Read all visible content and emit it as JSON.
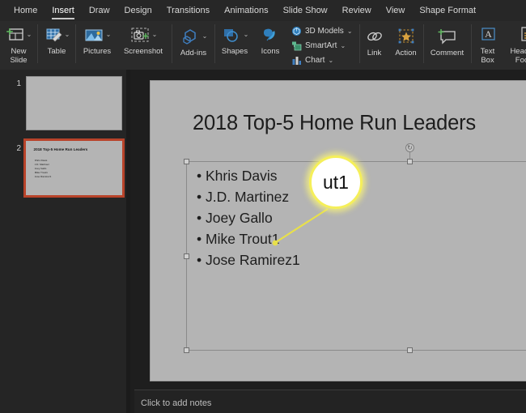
{
  "menu": {
    "items": [
      {
        "label": "Home",
        "active": false
      },
      {
        "label": "Insert",
        "active": true
      },
      {
        "label": "Draw",
        "active": false
      },
      {
        "label": "Design",
        "active": false
      },
      {
        "label": "Transitions",
        "active": false
      },
      {
        "label": "Animations",
        "active": false
      },
      {
        "label": "Slide Show",
        "active": false
      },
      {
        "label": "Review",
        "active": false
      },
      {
        "label": "View",
        "active": false
      },
      {
        "label": "Shape Format",
        "active": false
      }
    ]
  },
  "ribbon": {
    "new_slide": {
      "label": "New\nSlide",
      "icon": "new-slide-icon",
      "caret": "⌄"
    },
    "table": {
      "label": "Table",
      "icon": "table-icon",
      "caret": "⌄"
    },
    "pictures": {
      "label": "Pictures",
      "icon": "pictures-icon",
      "caret": "⌄"
    },
    "screenshot": {
      "label": "Screenshot",
      "icon": "screenshot-icon",
      "caret": "⌄"
    },
    "addins": {
      "label": "Add-ins",
      "icon": "addins-icon",
      "caret": "⌄"
    },
    "shapes": {
      "label": "Shapes",
      "icon": "shapes-icon",
      "caret": "⌄"
    },
    "icons": {
      "label": "Icons",
      "icon": "icons-icon",
      "caret": ""
    },
    "models3d": {
      "label": "3D Models",
      "icon": "3d-models-icon",
      "caret": "⌄"
    },
    "smartart": {
      "label": "SmartArt",
      "icon": "smartart-icon",
      "caret": "⌄"
    },
    "chart": {
      "label": "Chart",
      "icon": "chart-icon",
      "caret": "⌄"
    },
    "link": {
      "label": "Link",
      "icon": "link-icon"
    },
    "action": {
      "label": "Action",
      "icon": "action-icon"
    },
    "comment": {
      "label": "Comment",
      "icon": "comment-icon"
    },
    "textbox": {
      "label": "Text\nBox",
      "icon": "text-box-icon"
    },
    "headerfooter": {
      "label": "Header &\nFooter",
      "icon": "header-footer-icon"
    }
  },
  "thumbnails": [
    {
      "number": "1",
      "selected": false,
      "title": "",
      "bullets": []
    },
    {
      "number": "2",
      "selected": true,
      "title": "2018 Top-5 Home Run Leaders",
      "bullets": [
        "Khris Davis",
        "J.D. Martinez",
        "Joey Gallo",
        "Mike Trout1",
        "Jose Ramirez1"
      ]
    }
  ],
  "slide": {
    "title": "2018 Top-5 Home Run Leaders",
    "bullets": [
      "Khris Davis",
      "J.D. Martinez",
      "Joey Gallo",
      "Mike Trout1",
      "Jose Ramirez1"
    ],
    "rotate_handle_icon": "rotate-icon",
    "magnifier": {
      "text": "ut1",
      "ring_color": "#f5ef5a",
      "fill_color": "#ffffff"
    }
  },
  "notes": {
    "placeholder": "Click to add notes"
  },
  "colors": {
    "app_bg": "#1e1e1e",
    "ribbon_bg": "#2b2b2b",
    "menubar_bg": "#272727",
    "pane_bg": "#252525",
    "slide_bg": "#b4b4b4",
    "selection_accent": "#b8432a",
    "accent_blue": "#3f7fc1",
    "accent_gold": "#c9922f",
    "highlight_yellow": "#f5ef5a"
  }
}
